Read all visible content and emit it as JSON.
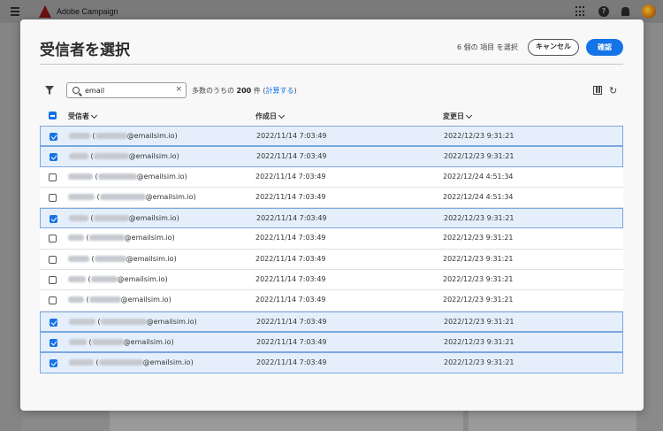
{
  "app": {
    "title": "Adobe Campaign"
  },
  "modal": {
    "title": "受信者を選択",
    "selected_text": "6 個の 項目 を選択",
    "cancel_label": "キャンセル",
    "confirm_label": "確認"
  },
  "toolbar": {
    "search_value": "email",
    "count_prefix": "多数のうちの",
    "count_value": "200",
    "count_unit": "件 (",
    "count_link": "計算する",
    "count_suffix": ")"
  },
  "table": {
    "headers": [
      "受信者",
      "作成日",
      "変更日"
    ],
    "rows": [
      {
        "selected": true,
        "email": "@emailsim.io",
        "created": "2022/11/14 7:03:49",
        "modified": "2022/12/23 9:31:21"
      },
      {
        "selected": true,
        "email": "@emailsim.io",
        "created": "2022/11/14 7:03:49",
        "modified": "2022/12/23 9:31:21"
      },
      {
        "selected": false,
        "email": "@emailsim.io",
        "created": "2022/11/14 7:03:49",
        "modified": "2022/12/24 4:51:34"
      },
      {
        "selected": false,
        "email": "@emailsim.io",
        "created": "2022/11/14 7:03:49",
        "modified": "2022/12/24 4:51:34"
      },
      {
        "selected": true,
        "email": "@emailsim.io",
        "created": "2022/11/14 7:03:49",
        "modified": "2022/12/23 9:31:21"
      },
      {
        "selected": false,
        "email": "@emailsim.io",
        "created": "2022/11/14 7:03:49",
        "modified": "2022/12/23 9:31:21"
      },
      {
        "selected": false,
        "email": "@emailsim.io",
        "created": "2022/11/14 7:03:49",
        "modified": "2022/12/23 9:31:21"
      },
      {
        "selected": false,
        "email": "@emailsim.io",
        "created": "2022/11/14 7:03:49",
        "modified": "2022/12/23 9:31:21"
      },
      {
        "selected": false,
        "email": "@emailsim.io",
        "created": "2022/11/14 7:03:49",
        "modified": "2022/12/23 9:31:21"
      },
      {
        "selected": true,
        "email": "@emailsim.io",
        "created": "2022/11/14 7:03:49",
        "modified": "2022/12/23 9:31:21"
      },
      {
        "selected": true,
        "email": "@emailsim.io",
        "created": "2022/11/14 7:03:49",
        "modified": "2022/12/23 9:31:21"
      },
      {
        "selected": true,
        "email": "@emailsim.io",
        "created": "2022/11/14 7:03:49",
        "modified": "2022/12/23 9:31:21"
      }
    ]
  },
  "colors": {
    "accent": "#1473e6",
    "selected_row": "#e5effb"
  }
}
